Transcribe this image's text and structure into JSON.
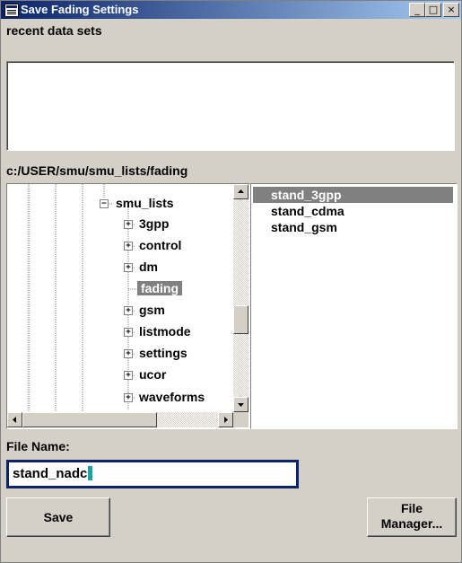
{
  "window": {
    "title": "Save Fading Settings",
    "buttons": {
      "minimize": "_",
      "maximize": "□",
      "close": "×"
    }
  },
  "recent": {
    "label": "recent data sets"
  },
  "path": "c:/USER/smu/smu_lists/fading",
  "tree": {
    "root": "smu_lists",
    "children": [
      "3gpp",
      "control",
      "dm",
      "fading",
      "gsm",
      "listmode",
      "settings",
      "ucor",
      "waveforms"
    ],
    "selected": "fading"
  },
  "files": {
    "items": [
      "stand_3gpp",
      "stand_cdma",
      "stand_gsm"
    ],
    "selected": "stand_3gpp"
  },
  "file_name": {
    "label": "File Name:",
    "value": "stand_nadc"
  },
  "actions": {
    "save": "Save",
    "file_manager_line1": "File",
    "file_manager_line2": "Manager..."
  }
}
